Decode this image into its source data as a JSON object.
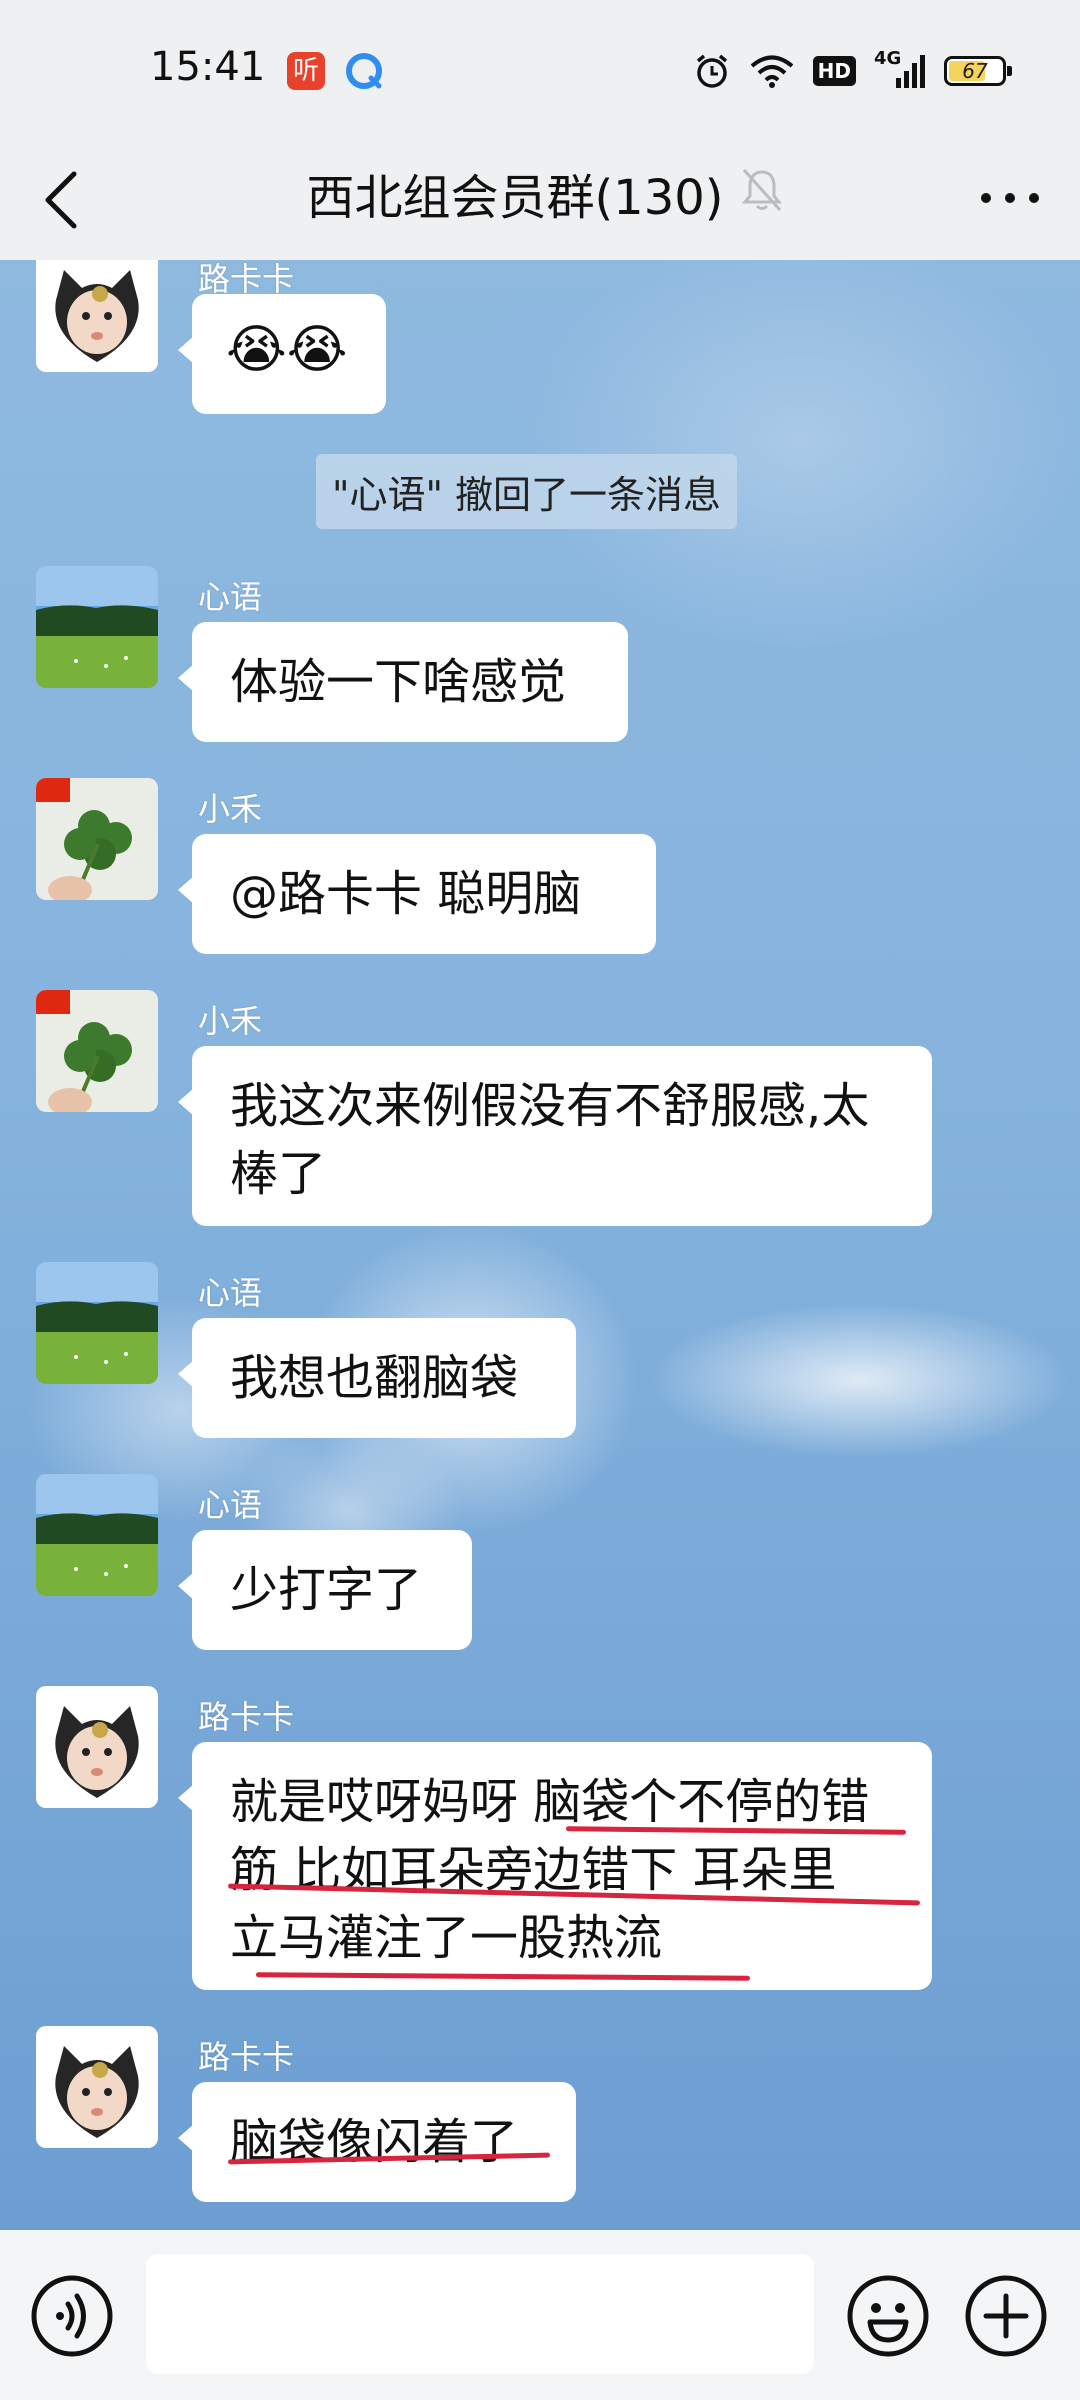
{
  "status_bar": {
    "time": "15:41",
    "app_icon_ting": "听",
    "hd": "HD",
    "network": "4G",
    "battery": "67"
  },
  "header": {
    "title": "西北组会员群(130)"
  },
  "system_notice": "\"心语\" 撤回了一条消息",
  "messages": [
    {
      "sender": "路卡卡",
      "text": "😭😭"
    },
    {
      "sender": "心语",
      "text": "体验一下啥感觉"
    },
    {
      "sender": "小禾",
      "text": "@路卡卡  聪明脑"
    },
    {
      "sender": "小禾",
      "line1": "我这次来例假没有不舒服感,太",
      "line2": "棒了"
    },
    {
      "sender": "心语",
      "text": "我想也翻脑袋"
    },
    {
      "sender": "心语",
      "text": "少打字了"
    },
    {
      "sender": "路卡卡",
      "line1": "就是哎呀妈呀 脑袋个不停的错",
      "line2": "筋 比如耳朵旁边错下 耳朵里",
      "line3": "立马灌注了一股热流"
    },
    {
      "sender": "路卡卡",
      "text": "脑袋像闪着了"
    }
  ],
  "input": {
    "placeholder": ""
  },
  "icons": {
    "back": "chevron-left-icon",
    "mute": "bell-off-icon",
    "more": "more-dots-icon",
    "voice": "voice-icon",
    "emoji": "emoji-icon",
    "plus": "plus-icon"
  },
  "colors": {
    "underline": "#d6253e",
    "battery": "#f4d35e"
  }
}
